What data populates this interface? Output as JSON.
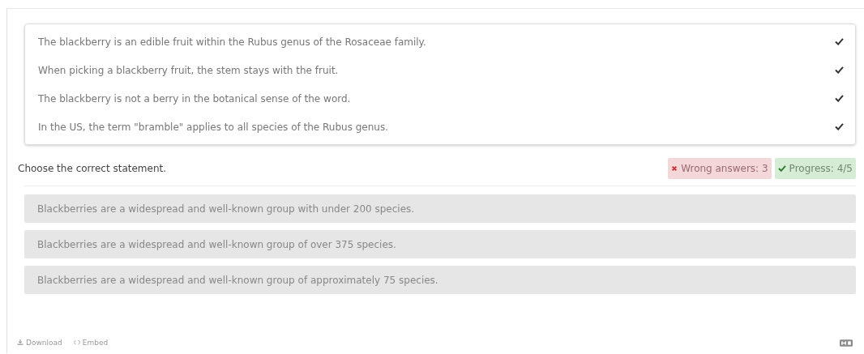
{
  "statements": [
    {
      "text": "The blackberry is an edible fruit within the Rubus genus of the Rosaceae family.",
      "checked": true
    },
    {
      "text": "When picking a blackberry fruit, the stem stays with the fruit.",
      "checked": true
    },
    {
      "text": "The blackberry is not a berry in the botanical sense of the word.",
      "checked": true
    },
    {
      "text": "In the US, the term \"bramble\" applies to all species of the Rubus genus.",
      "checked": true
    }
  ],
  "question": "Choose the correct statement.",
  "wrong_answers": "Wrong answers: 3",
  "progress": "Progress: 4/5",
  "answers": [
    {
      "text": "Blackberries are a widespread and well-known group with under 200 species."
    },
    {
      "text": "Blackberries are a widespread and well-known group of over 375 species."
    },
    {
      "text": "Blackberries are a widespread and well-known group of approximately 75 species."
    }
  ],
  "footer": {
    "download": "Download",
    "embed": "Embed"
  }
}
